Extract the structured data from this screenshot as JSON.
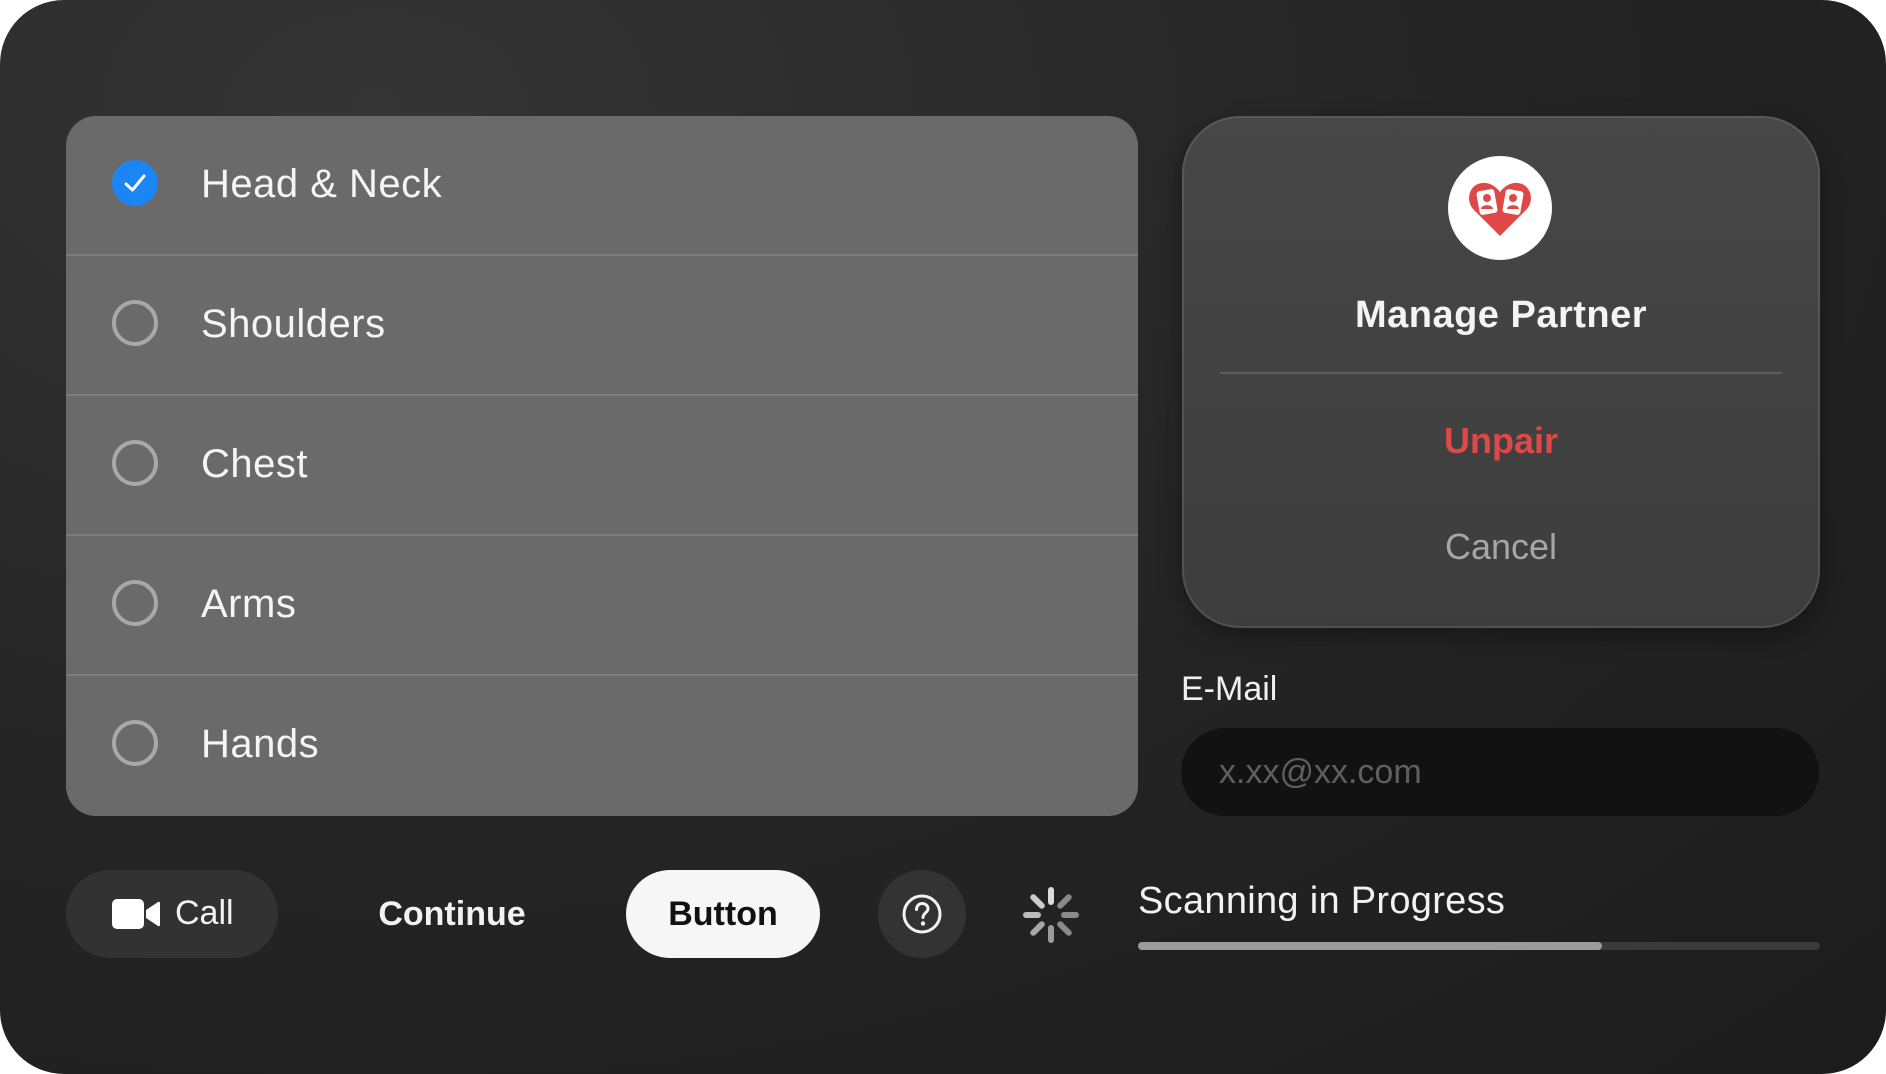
{
  "body_parts": {
    "items": [
      {
        "label": "Head & Neck",
        "checked": true
      },
      {
        "label": "Shoulders",
        "checked": false
      },
      {
        "label": "Chest",
        "checked": false
      },
      {
        "label": "Arms",
        "checked": false
      },
      {
        "label": "Hands",
        "checked": false
      }
    ]
  },
  "dialog": {
    "icon": "partner-heart-icon",
    "title": "Manage Partner",
    "unpair_label": "Unpair",
    "cancel_label": "Cancel"
  },
  "email": {
    "label": "E-Mail",
    "placeholder": "x.xx@xx.com",
    "value": ""
  },
  "controls": {
    "call_icon": "video-camera-icon",
    "call_label": "Call",
    "continue_label": "Continue",
    "button_label": "Button",
    "help_icon": "question-mark-icon",
    "spinner_icon": "loading-spinner-icon"
  },
  "scan": {
    "label": "Scanning in Progress",
    "progress": 0.68
  },
  "colors": {
    "accent": "#1a85f5",
    "destructive": "#e04848",
    "app_icon": "#e04848"
  }
}
